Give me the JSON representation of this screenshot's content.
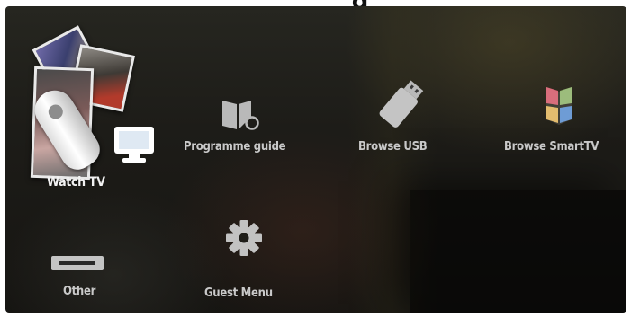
{
  "header": {
    "title_fragment": "g"
  },
  "menu": {
    "items": [
      {
        "id": "watch-tv",
        "label": "Watch TV",
        "icon": "tv-icon",
        "selected": true
      },
      {
        "id": "programme-guide",
        "label": "Programme guide",
        "icon": "book-icon"
      },
      {
        "id": "browse-usb",
        "label": "Browse USB",
        "icon": "usb-stick-icon"
      },
      {
        "id": "browse-smarttv",
        "label": "Browse SmartTV",
        "icon": "smarttv-icon"
      },
      {
        "id": "other",
        "label": "Other",
        "icon": "device-icon"
      },
      {
        "id": "guest-menu",
        "label": "Guest Menu",
        "icon": "gear-icon"
      }
    ]
  },
  "colors": {
    "label_text": "#c9c9c9",
    "selected_label_text": "#f2f2f2",
    "icon_fill": "#b9b9b9",
    "background": "#1d1c18"
  }
}
